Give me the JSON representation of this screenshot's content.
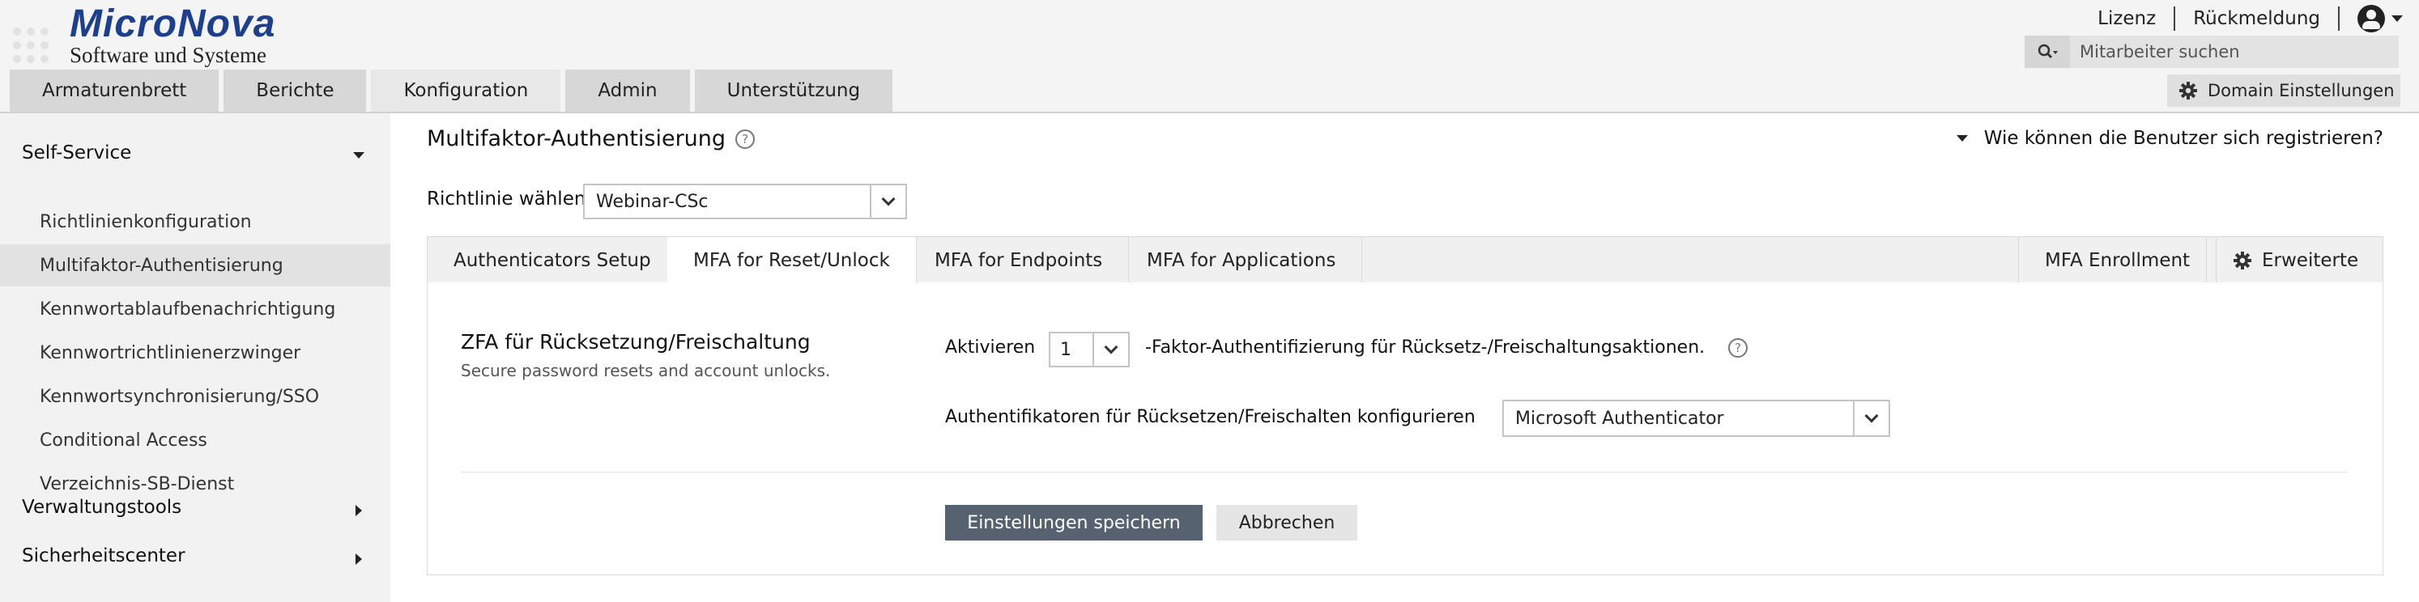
{
  "brand": {
    "name": "MicroNova",
    "tagline": "Software und Systeme"
  },
  "top_links": {
    "license": "Lizenz",
    "feedback": "Rückmeldung"
  },
  "search": {
    "placeholder": "Mitarbeiter suchen"
  },
  "domain_settings": {
    "label": "Domain Einstellungen"
  },
  "nav": {
    "tabs": [
      {
        "label": "Armaturenbrett"
      },
      {
        "label": "Berichte"
      },
      {
        "label": "Konfiguration",
        "active": true
      },
      {
        "label": "Admin"
      },
      {
        "label": "Unterstützung"
      }
    ]
  },
  "sidebar": {
    "sections": [
      {
        "title": "Self-Service",
        "expanded": true,
        "items": [
          {
            "label": "Richtlinienkonfiguration"
          },
          {
            "label": "Multifaktor-Authentisierung",
            "active": true
          },
          {
            "label": "Kennwortablaufbenachrichtigung"
          },
          {
            "label": "Kennwortrichtlinienerzwinger"
          },
          {
            "label": "Kennwortsynchronisierung/SSO"
          },
          {
            "label": "Conditional Access"
          },
          {
            "label": "Verzeichnis-SB-Dienst"
          }
        ]
      },
      {
        "title": "Verwaltungstools",
        "expanded": false
      },
      {
        "title": "Sicherheitscenter",
        "expanded": false
      }
    ]
  },
  "main": {
    "title": "Multifaktor-Authentisierung",
    "register_link": "Wie können die Benutzer sich registrieren?",
    "policy": {
      "label": "Richtlinie wählen",
      "value": "Webinar-CSc"
    },
    "tabs": [
      {
        "label": "Authenticators Setup"
      },
      {
        "label": "MFA for Reset/Unlock",
        "active": true
      },
      {
        "label": "MFA for Endpoints"
      },
      {
        "label": "MFA for Applications"
      }
    ],
    "right_tabs": {
      "enrollment": "MFA Enrollment",
      "advanced": "Erweiterte"
    },
    "section": {
      "title": "ZFA für Rücksetzung/Freischaltung",
      "description": "Secure password resets and account unlocks.",
      "enable_label": "Aktivieren",
      "factor_count": "1",
      "factor_suffix": "-Faktor-Authentifizierung für Rücksetz-/Freischaltungsaktionen.",
      "authenticators_label": "Authentifikatoren für Rücksetzen/Freischalten konfigurieren",
      "authenticator_value": "Microsoft Authenticator"
    },
    "buttons": {
      "save": "Einstellungen speichern",
      "cancel": "Abbrechen"
    }
  },
  "colors": {
    "brand": "#1d3f8f",
    "primary_button": "#566270",
    "sidebar_bg": "#f2f2f2",
    "header_bg": "#f4f4f4"
  }
}
